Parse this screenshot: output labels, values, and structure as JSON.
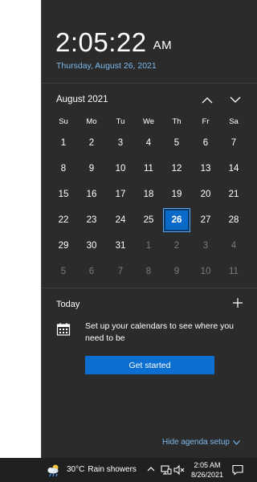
{
  "clock": {
    "time": "2:05:22",
    "ampm": "AM",
    "date": "Thursday, August 26, 2021"
  },
  "calendar": {
    "month_label": "August 2021",
    "weekdays": [
      "Su",
      "Mo",
      "Tu",
      "We",
      "Th",
      "Fr",
      "Sa"
    ],
    "selected_day": "26",
    "weeks": [
      [
        {
          "d": "1",
          "m": false
        },
        {
          "d": "2",
          "m": false
        },
        {
          "d": "3",
          "m": false
        },
        {
          "d": "4",
          "m": false
        },
        {
          "d": "5",
          "m": false
        },
        {
          "d": "6",
          "m": false
        },
        {
          "d": "7",
          "m": false
        }
      ],
      [
        {
          "d": "8",
          "m": false
        },
        {
          "d": "9",
          "m": false
        },
        {
          "d": "10",
          "m": false
        },
        {
          "d": "11",
          "m": false
        },
        {
          "d": "12",
          "m": false
        },
        {
          "d": "13",
          "m": false
        },
        {
          "d": "14",
          "m": false
        }
      ],
      [
        {
          "d": "15",
          "m": false
        },
        {
          "d": "16",
          "m": false
        },
        {
          "d": "17",
          "m": false
        },
        {
          "d": "18",
          "m": false
        },
        {
          "d": "19",
          "m": false
        },
        {
          "d": "20",
          "m": false
        },
        {
          "d": "21",
          "m": false
        }
      ],
      [
        {
          "d": "22",
          "m": false
        },
        {
          "d": "23",
          "m": false
        },
        {
          "d": "24",
          "m": false
        },
        {
          "d": "25",
          "m": false
        },
        {
          "d": "26",
          "m": false
        },
        {
          "d": "27",
          "m": false
        },
        {
          "d": "28",
          "m": false
        }
      ],
      [
        {
          "d": "29",
          "m": false
        },
        {
          "d": "30",
          "m": false
        },
        {
          "d": "31",
          "m": false
        },
        {
          "d": "1",
          "m": true
        },
        {
          "d": "2",
          "m": true
        },
        {
          "d": "3",
          "m": true
        },
        {
          "d": "4",
          "m": true
        }
      ],
      [
        {
          "d": "5",
          "m": true
        },
        {
          "d": "6",
          "m": true
        },
        {
          "d": "7",
          "m": true
        },
        {
          "d": "8",
          "m": true
        },
        {
          "d": "9",
          "m": true
        },
        {
          "d": "10",
          "m": true
        },
        {
          "d": "11",
          "m": true
        }
      ]
    ]
  },
  "agenda": {
    "title": "Today",
    "message": "Set up your calendars to see where you need to be",
    "button_label": "Get started",
    "hide_label": "Hide agenda setup"
  },
  "taskbar": {
    "temperature": "30°C",
    "condition": "Rain showers",
    "time": "2:05 AM",
    "date": "8/26/2021"
  },
  "icons": {
    "nav_prev": "chevron-up-icon",
    "nav_next": "chevron-down-icon",
    "add": "plus-icon",
    "calendar": "calendar-icon",
    "weather": "rain-cloud-icon",
    "tray_overflow": "chevron-up-icon",
    "network": "network-icon",
    "volume": "volume-muted-icon",
    "notifications": "notification-icon"
  },
  "colors": {
    "flyout_bg": "#2b2b2b",
    "accent": "#0b6fd1",
    "link": "#7cb9ee",
    "taskbar_bg": "#202020",
    "muted_text": "#7b7b7b"
  }
}
